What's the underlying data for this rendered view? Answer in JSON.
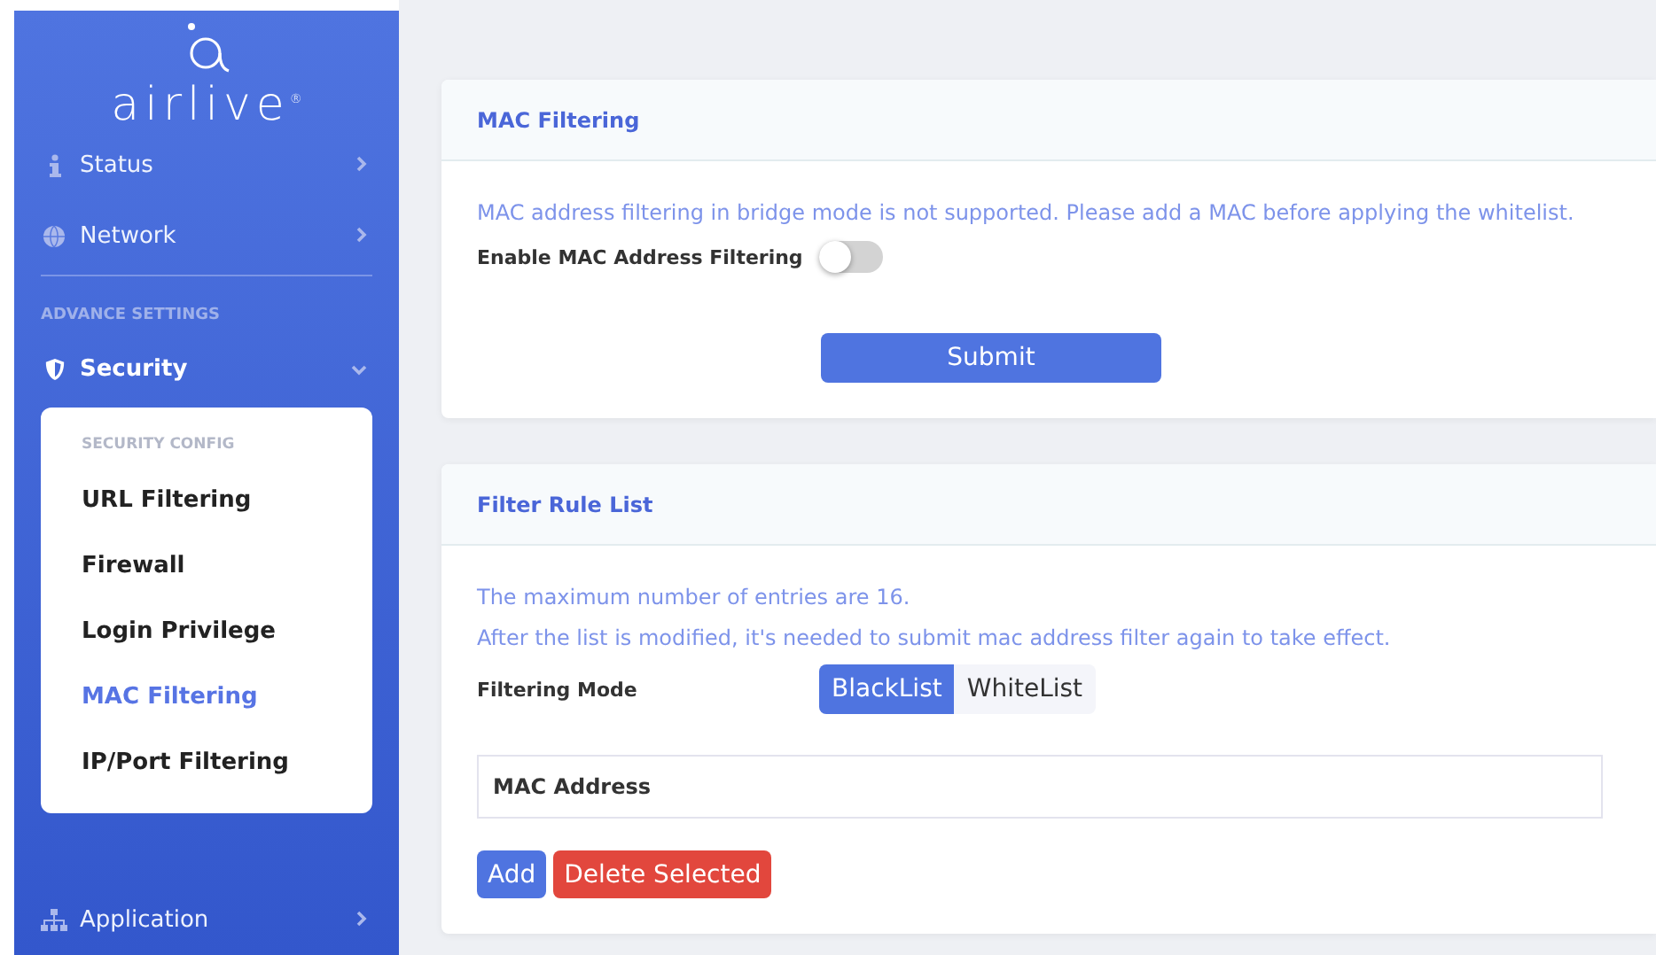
{
  "sidebar": {
    "logo": {
      "text": "airlive",
      "mark": "®"
    },
    "items": [
      {
        "label": "Status",
        "expanded": false
      },
      {
        "label": "Network",
        "expanded": false
      }
    ],
    "section_heading": "ADVANCE SETTINGS",
    "section_items": [
      {
        "label": "Security",
        "expanded": true,
        "submenu": {
          "heading": "SECURITY CONFIG",
          "items": [
            {
              "label": "URL Filtering",
              "selected": false
            },
            {
              "label": "Firewall",
              "selected": false
            },
            {
              "label": "Login Privilege",
              "selected": false
            },
            {
              "label": "MAC Filtering",
              "selected": true
            },
            {
              "label": "IP/Port Filtering",
              "selected": false
            }
          ]
        }
      },
      {
        "label": "Application",
        "expanded": false
      }
    ]
  },
  "mac_filtering": {
    "title": "MAC Filtering",
    "notice": "MAC address filtering in bridge mode is not supported. Please add a MAC before applying the whitelist.",
    "toggle": {
      "label": "Enable MAC Address Filtering",
      "on": false
    },
    "submit": "Submit"
  },
  "filter_rule_list": {
    "title": "Filter Rule List",
    "notes": [
      "The maximum number of entries are 16.",
      "After the list is modified, it's needed to submit mac address filter again to take effect."
    ],
    "mode": {
      "label": "Filtering Mode",
      "options": [
        {
          "label": "BlackList",
          "selected": true
        },
        {
          "label": "WhiteList",
          "selected": false
        }
      ]
    },
    "table": {
      "columns": [
        "MAC Address"
      ]
    },
    "buttons": [
      {
        "label": "Add",
        "kind": "primary"
      },
      {
        "label": "Delete Selected",
        "kind": "danger"
      }
    ]
  }
}
